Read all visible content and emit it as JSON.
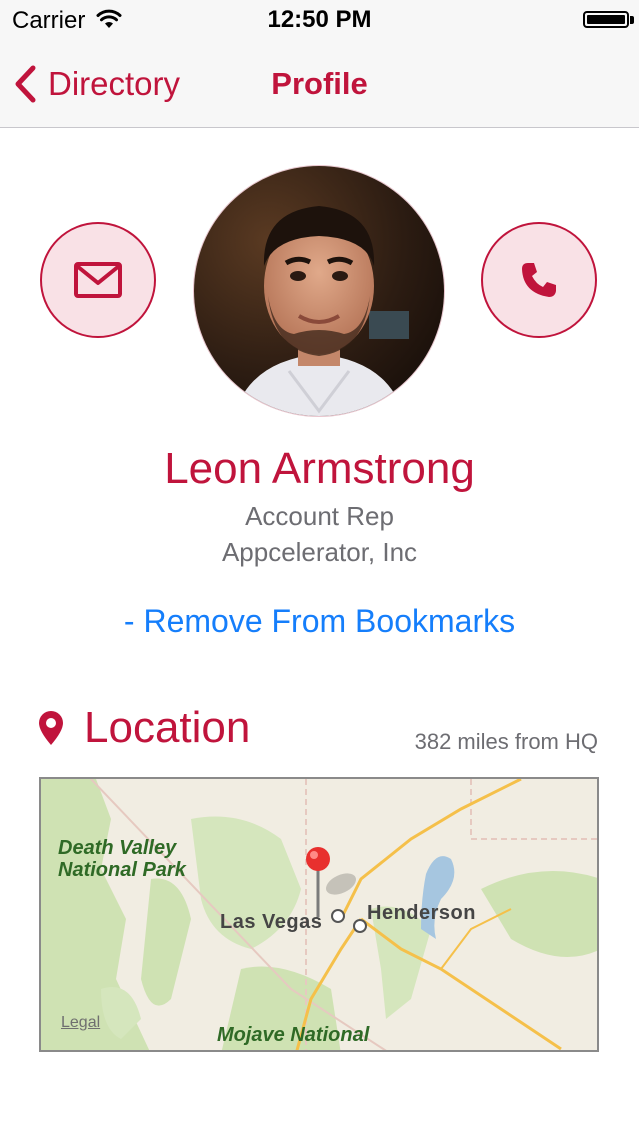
{
  "status_bar": {
    "carrier": "Carrier",
    "time": "12:50 PM",
    "battery_level": 1.0
  },
  "nav": {
    "back_label": "Directory",
    "title": "Profile"
  },
  "profile": {
    "name": "Leon Armstrong",
    "role": "Account Rep",
    "company": "Appcelerator, Inc",
    "bookmark_action": "- Remove From Bookmarks",
    "email_icon": "envelope-icon",
    "phone_icon": "phone-icon"
  },
  "location": {
    "title": "Location",
    "distance": "382 miles from HQ",
    "icon": "map-pin-icon"
  },
  "map": {
    "labels": {
      "park_1_line1": "Death Valley",
      "park_1_line2": "National Park",
      "park_2": "Mojave National",
      "city_1": "Las Vegas",
      "city_2": "Henderson"
    },
    "legal": "Legal"
  },
  "colors": {
    "accent": "#c0143c",
    "accent_light": "#f9e1e6",
    "link": "#157efb",
    "secondary_text": "#6d6d72"
  }
}
